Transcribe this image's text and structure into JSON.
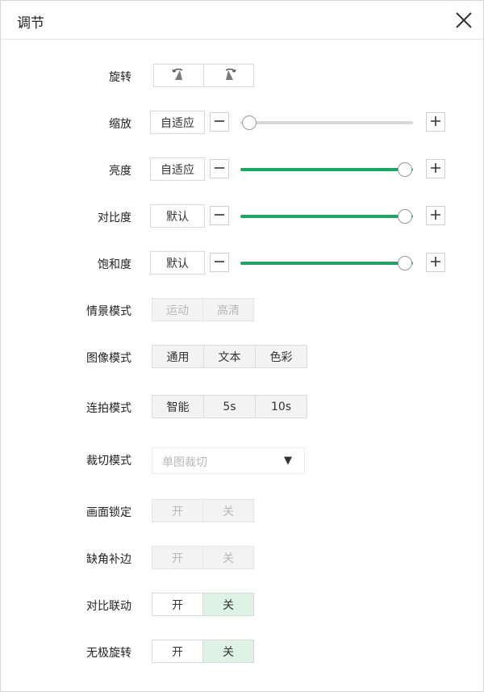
{
  "dialog": {
    "title": "调节"
  },
  "rotate": {
    "label": "旋转",
    "buttons": [
      "",
      ""
    ]
  },
  "zoom": {
    "label": "缩放",
    "auto_label": "自适应",
    "value": 0.0
  },
  "brightness": {
    "label": "亮度",
    "auto_label": "自适应",
    "value": 1.0
  },
  "contrast": {
    "label": "对比度",
    "auto_label": "默认",
    "value": 1.0
  },
  "saturation": {
    "label": "饱和度",
    "auto_label": "默认",
    "value": 1.0
  },
  "scene_mode": {
    "label": "情景模式",
    "options": [
      "运动",
      "高清"
    ]
  },
  "image_mode": {
    "label": "图像模式",
    "options": [
      "通用",
      "文本",
      "色彩"
    ]
  },
  "burst_mode": {
    "label": "连拍模式",
    "options": [
      "智能",
      "5s",
      "10s"
    ]
  },
  "crop_mode": {
    "label": "裁切模式",
    "value": "单图裁切"
  },
  "frame_lock": {
    "label": "画面锁定",
    "options": [
      "开",
      "关"
    ]
  },
  "corner_fill": {
    "label": "缺角补边",
    "options": [
      "开",
      "关"
    ]
  },
  "contrast_link": {
    "label": "对比联动",
    "options": [
      "开",
      "关"
    ],
    "selected": "关"
  },
  "free_rotate": {
    "label": "无极旋转",
    "options": [
      "开",
      "关"
    ],
    "selected": "关"
  },
  "colors": {
    "accent": "#1fa463",
    "selected_bg": "#dff2e6"
  }
}
